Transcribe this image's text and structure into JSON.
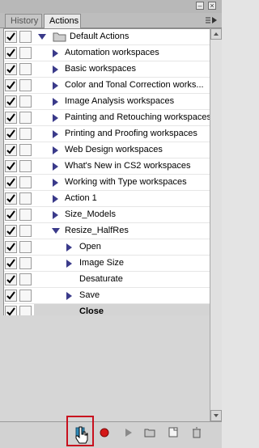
{
  "tabs": {
    "history": "History",
    "actions": "Actions"
  },
  "colors": {
    "highlight": "#c8101e",
    "selected_row": "#d4d4d4"
  },
  "rows": [
    {
      "label": "Default Actions",
      "type": "set",
      "expanded": true
    },
    {
      "label": "Automation workspaces",
      "type": "action"
    },
    {
      "label": "Basic workspaces",
      "type": "action"
    },
    {
      "label": "Color and Tonal Correction works...",
      "type": "action"
    },
    {
      "label": "Image Analysis workspaces",
      "type": "action"
    },
    {
      "label": "Painting and Retouching workspaces",
      "type": "action"
    },
    {
      "label": "Printing and Proofing workspaces",
      "type": "action"
    },
    {
      "label": "Web Design workspaces",
      "type": "action"
    },
    {
      "label": "What's New in CS2 workspaces",
      "type": "action"
    },
    {
      "label": "Working with Type workspaces",
      "type": "action"
    },
    {
      "label": "Action 1",
      "type": "action"
    },
    {
      "label": "Size_Models",
      "type": "action"
    },
    {
      "label": "Resize_HalfRes",
      "type": "action",
      "expanded": true
    },
    {
      "label": "Open",
      "type": "step"
    },
    {
      "label": "Image Size",
      "type": "step"
    },
    {
      "label": "Desaturate",
      "type": "step"
    },
    {
      "label": "Save",
      "type": "step"
    },
    {
      "label": "Close",
      "type": "step",
      "selected": true
    }
  ],
  "bottom_buttons": [
    "stop-button",
    "record-button",
    "play-button",
    "new-set-button",
    "new-action-button",
    "delete-button"
  ]
}
